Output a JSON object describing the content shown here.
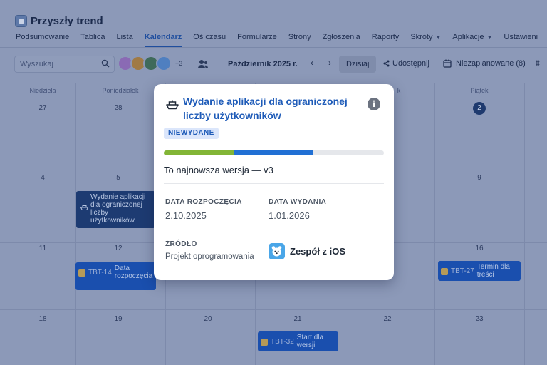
{
  "project": {
    "title": "Przyszły trend"
  },
  "tabs": [
    {
      "label": "Podsumowanie"
    },
    {
      "label": "Tablica"
    },
    {
      "label": "Lista"
    },
    {
      "label": "Kalendarz"
    },
    {
      "label": "Oś czasu"
    },
    {
      "label": "Formularze"
    },
    {
      "label": "Strony"
    },
    {
      "label": "Zgłoszenia"
    },
    {
      "label": "Raporty"
    },
    {
      "label": "Skróty"
    },
    {
      "label": "Aplikacje"
    },
    {
      "label": "Ustawieni"
    }
  ],
  "toolbar": {
    "search_placeholder": "Wyszukaj",
    "more_avatars": "+3",
    "month": "Październik 2025 r.",
    "today": "Dzisiaj",
    "share": "Udostępnij",
    "unscheduled": "Niezaplanowane (8)"
  },
  "calendar": {
    "weekdays": [
      "Niedziela",
      "Poniedziałek",
      "",
      "",
      "",
      "Piątek"
    ],
    "weeks": [
      [
        "27",
        "28",
        "",
        "",
        "",
        "2"
      ],
      [
        "4",
        "5",
        "",
        "",
        "",
        "9"
      ],
      [
        "11",
        "12",
        "",
        "",
        "",
        "16"
      ],
      [
        "18",
        "19",
        "20",
        "21",
        "22",
        "23"
      ]
    ],
    "partial_weekday": "k",
    "events": {
      "release": {
        "title": "Wydanie aplikacji dla ograniczonej liczby użytkowników"
      },
      "tbt14": {
        "key": "TBT-14",
        "title": "Data rozpoczęcia"
      },
      "tbt27": {
        "key": "TBT-27",
        "title": "Termin dla treści"
      },
      "tbt32": {
        "key": "TBT-32",
        "title": "Start dla wersji"
      }
    }
  },
  "popup": {
    "title": "Wydanie aplikacji dla ograniczonej liczby użytkowników",
    "status": "NIEWYDANE",
    "progress": {
      "done_fraction": 0.32,
      "in_progress_fraction": 0.36
    },
    "description": "To najnowsza wersja — v3",
    "start_label": "DATA ROZPOCZĘCIA",
    "start_value": "2.10.2025",
    "release_label": "DATA WYDANIA",
    "release_value": "1.01.2026",
    "source_label": "ŹRÓDŁO",
    "source_value": "Projekt oprogramowania",
    "team": "Zespół z iOS"
  },
  "colors": {
    "accent": "#1e5bb8",
    "progress_done": "#82b536",
    "progress_in_progress": "#2170d4"
  }
}
